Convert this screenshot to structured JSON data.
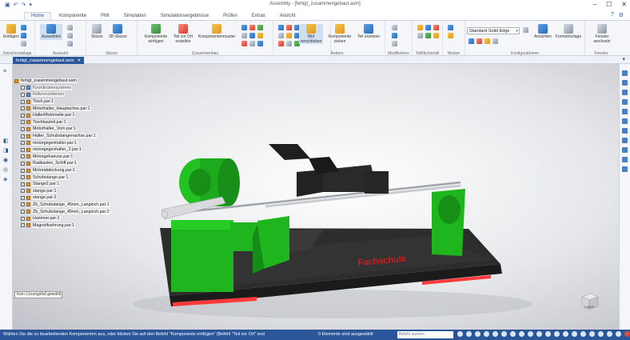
{
  "window": {
    "title": "Assembly - [fertigt_zusammengebaut.asm]",
    "quick_access": [
      "save-icon",
      "undo-icon",
      "redo-icon",
      "customize-icon"
    ]
  },
  "tabs": [
    {
      "label": "Home",
      "active": true
    },
    {
      "label": "Komponente",
      "active": false
    },
    {
      "label": "PMI",
      "active": false
    },
    {
      "label": "Simulation",
      "active": false
    },
    {
      "label": "Simulationsergebnisse",
      "active": false
    },
    {
      "label": "Prüfen",
      "active": false
    },
    {
      "label": "Extras",
      "active": false
    },
    {
      "label": "Ansicht",
      "active": false
    }
  ],
  "ribbon": {
    "groups": [
      {
        "name": "Zwischenablage",
        "buttons": [
          "Einfügen"
        ]
      },
      {
        "name": "Auswahl",
        "buttons": [
          "Auswählen"
        ]
      },
      {
        "name": "Skizze",
        "buttons": [
          "Skizze",
          "3D-Skizze"
        ]
      },
      {
        "name": "Zusammenbau",
        "buttons": [
          "Komponente einfügen",
          "Teil vor Ort erstellen",
          "Komponentenmuster"
        ]
      },
      {
        "name": "Ändern",
        "buttons": [
          "Bild verschieben",
          "Komponente ziehen",
          "Teil ersetzen"
        ]
      },
      {
        "name": "Modifizieren",
        "buttons": []
      },
      {
        "name": "Teilflächenstil",
        "buttons": []
      },
      {
        "name": "Muster",
        "buttons": []
      },
      {
        "name": "Konfigurationen",
        "buttons": [
          "Ansichten",
          "Formatvorlage"
        ]
      },
      {
        "name": "Fenster",
        "buttons": [
          "Fenster wechseln"
        ]
      }
    ],
    "style_combo": "Standard Solid Edge"
  },
  "document_tab": "fertigt_zusammengebaut.asm",
  "tree": {
    "root": "fertigt_zusammengebaut.asm",
    "items": [
      {
        "label": "Koordinatensysteme",
        "kind": "system",
        "checked": false
      },
      {
        "label": "Referenzebenen",
        "kind": "system",
        "checked": false
      },
      {
        "label": "Tisch.par:1",
        "kind": "part",
        "checked": true
      },
      {
        "label": "Motorhalter_Hauptachse.par:1",
        "kind": "part",
        "checked": true
      },
      {
        "label": "HalterMotorseite.par:1",
        "kind": "part",
        "checked": true
      },
      {
        "label": "Tischbauteil.par:1",
        "kind": "part",
        "checked": true
      },
      {
        "label": "Motorhalter_Vorn.par:1",
        "kind": "part",
        "checked": true
      },
      {
        "label": "Halter_Schubstangenachse.par:1",
        "kind": "part",
        "checked": true
      },
      {
        "label": "motorgegenhalter.par:1",
        "kind": "part",
        "checked": true
      },
      {
        "label": "motorgegenhalter_2.par:1",
        "kind": "part",
        "checked": true
      },
      {
        "label": "Motorgehaeuse.par:1",
        "kind": "part",
        "checked": true
      },
      {
        "label": "Radkasten_Schiff.par:1",
        "kind": "part",
        "checked": true
      },
      {
        "label": "Motorabdeckung.par:1",
        "kind": "part",
        "checked": true
      },
      {
        "label": "Schubstange.par:1",
        "kind": "part",
        "checked": true
      },
      {
        "label": "Stange2.par:1",
        "kind": "part",
        "checked": true
      },
      {
        "label": "stange.par:1",
        "kind": "part",
        "checked": true
      },
      {
        "label": "stange.par:2",
        "kind": "part",
        "checked": true
      },
      {
        "label": "Zb_Schubstange_45mm_Langloch.par:1",
        "kind": "part",
        "checked": true
      },
      {
        "label": "Zb_Schubstange_45mm_Langloch.par:2",
        "kind": "part",
        "checked": true
      },
      {
        "label": "Hammer.par:1",
        "kind": "part",
        "checked": true
      },
      {
        "label": "Magnetfuehrung.par:1",
        "kind": "part",
        "checked": true
      }
    ]
  },
  "viewport": {
    "selection_info": "Kein Lösungsfall gewählt",
    "base_engraving": "Fachschule",
    "view_cube_label": "LINKS",
    "colors": {
      "green": "#22c222",
      "dark": "#2a2a2a",
      "red": "#ff3333"
    }
  },
  "status": {
    "message": "Wählen Sie die zu bearbeitenden Komponenten aus, oder klicken Sie auf den Befehl \"Komponente einfügen\" (Befehl \"Teil vor Ort\" erst",
    "count": "0 Elemente sind ausgewählt",
    "search_placeholder": "Befehl suchen"
  }
}
